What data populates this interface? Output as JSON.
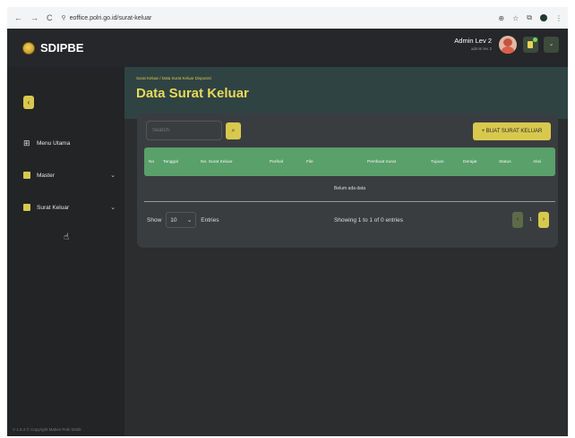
{
  "browser": {
    "url": "eoffice.polri.go.id/surat-keluar",
    "nav_back": "←",
    "nav_forward": "→",
    "nav_reload": "C",
    "site_icon": "⚲",
    "right_icons": [
      "⊕",
      "☆",
      "⧉"
    ]
  },
  "app": {
    "logo_text": "SDIPBE",
    "collapse_icon": "‹",
    "menu": [
      {
        "label": "Menu Utama",
        "icon": "grid-icon",
        "chevron": ""
      },
      {
        "label": "Master",
        "icon": "folder-icon",
        "chevron": "⌄"
      },
      {
        "label": "Surat Keluar",
        "icon": "mail-icon",
        "chevron": "⌄"
      }
    ],
    "copyright": "V 1.0.4 © Copyright Mabes Polri Divtik"
  },
  "topbar": {
    "admin_name": "Admin Lev 2",
    "admin_sub": "admin lev 2",
    "dropdown_icon": "⌄"
  },
  "page": {
    "breadcrumb": "Surat Keluar / Data Surat Keluar Disposisi",
    "title": "Data Surat Keluar"
  },
  "toolbar": {
    "search_placeholder": "Search",
    "search_icon": "⌕",
    "add_label": "+ BUAT SURAT KELUAR"
  },
  "table": {
    "headers": [
      "No",
      "Tanggal",
      "No. Surat Keluar",
      "Perihal",
      "File",
      "Pembuat Surat",
      "Tujuan",
      "Derajat",
      "Status",
      "Aksi"
    ],
    "empty_text": "Belum ada data"
  },
  "footer": {
    "show_label": "Show",
    "page_size": "10",
    "entries_label": "Entries",
    "showing_text": "Showing 1 to 1 of 0 entries",
    "prev": "‹",
    "page_number": "1",
    "next": "›"
  },
  "colors": {
    "accent": "#d9c84e",
    "table_header": "#5aa06b",
    "sidebar": "#222426",
    "background": "#2b2d2f"
  }
}
